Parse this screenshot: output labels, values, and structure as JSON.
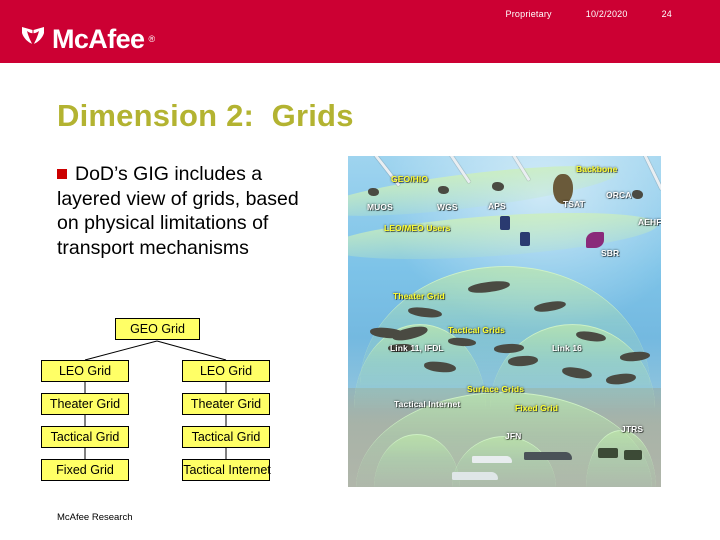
{
  "header": {
    "band_color": "#cc0033",
    "logo": {
      "mark_icon": "mcafee-shield-icon",
      "wordmark": "McAfee",
      "trademark": "®"
    },
    "meta": {
      "classification": "Proprietary",
      "date": "10/2/2020",
      "slide_number": "24"
    }
  },
  "slide": {
    "title": "Dimension 2:  Grids",
    "title_color": "#b3b331",
    "bullet": {
      "marker_color": "#cc0000",
      "text": "DoD’s GIG includes a layered view of grids, based on physical limitations of transport mechanisms"
    }
  },
  "diagram": {
    "box_fill": "#ffff66",
    "box_border": "#000000",
    "root": "GEO Grid",
    "left_column": [
      "LEO Grid",
      "Theater Grid",
      "Tactical Grid",
      "Fixed Grid"
    ],
    "right_column": [
      "LEO Grid",
      "Theater Grid",
      "Tactical Grid",
      "Tactical Internet"
    ]
  },
  "illustration": {
    "name": "gig-layered-grids-diagram",
    "label_color": "#ffff33",
    "labels": [
      "GEO/HIO",
      "MUOS",
      "WGS",
      "APS",
      "Backbone",
      "TSAT",
      "ORCA",
      "AEHF",
      "LEO/MEO Users",
      "SBR",
      "Theater Grid",
      "Tactical Grids",
      "Link 11, IFDL",
      "Link 16",
      "Surface Grids",
      "Tactical Internet",
      "Fixed Grid",
      "JFN",
      "JTRS"
    ]
  },
  "footer": {
    "text": "McAfee Research"
  }
}
